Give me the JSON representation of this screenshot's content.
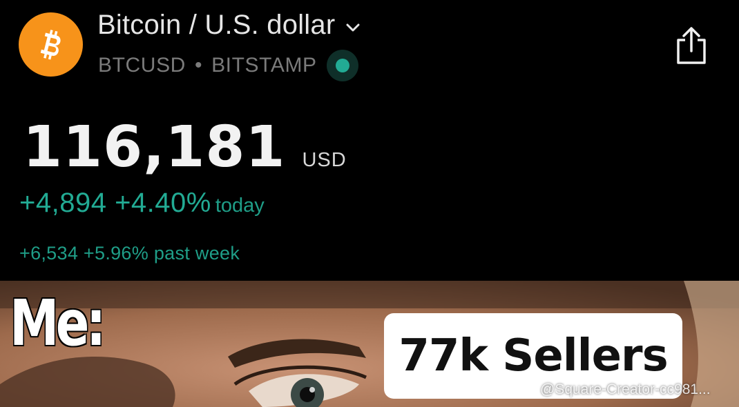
{
  "header": {
    "title": "Bitcoin / U.S. dollar",
    "symbol": "BTCUSD",
    "separator": "•",
    "exchange": "BITSTAMP",
    "logo_icon": "bitcoin-logo-icon",
    "dropdown_icon": "chevron-down-icon",
    "share_icon": "share-icon",
    "live_icon": "live-status-dot-icon"
  },
  "quote": {
    "price": "116,181",
    "currency": "USD",
    "change_today": "+4,894 +4.40%",
    "change_today_label": "today",
    "change_week": "+6,534 +5.96% past week"
  },
  "meme": {
    "me_label": "Me:",
    "sellers_label": "77k Sellers",
    "watermark": "@Square-Creator-cc981...",
    "watermark_icon": "binance-square-icon"
  },
  "colors": {
    "background": "#000000",
    "bitcoin_orange": "#f7931a",
    "positive_green": "#22ab94",
    "muted_gray": "#7b7b7b"
  }
}
